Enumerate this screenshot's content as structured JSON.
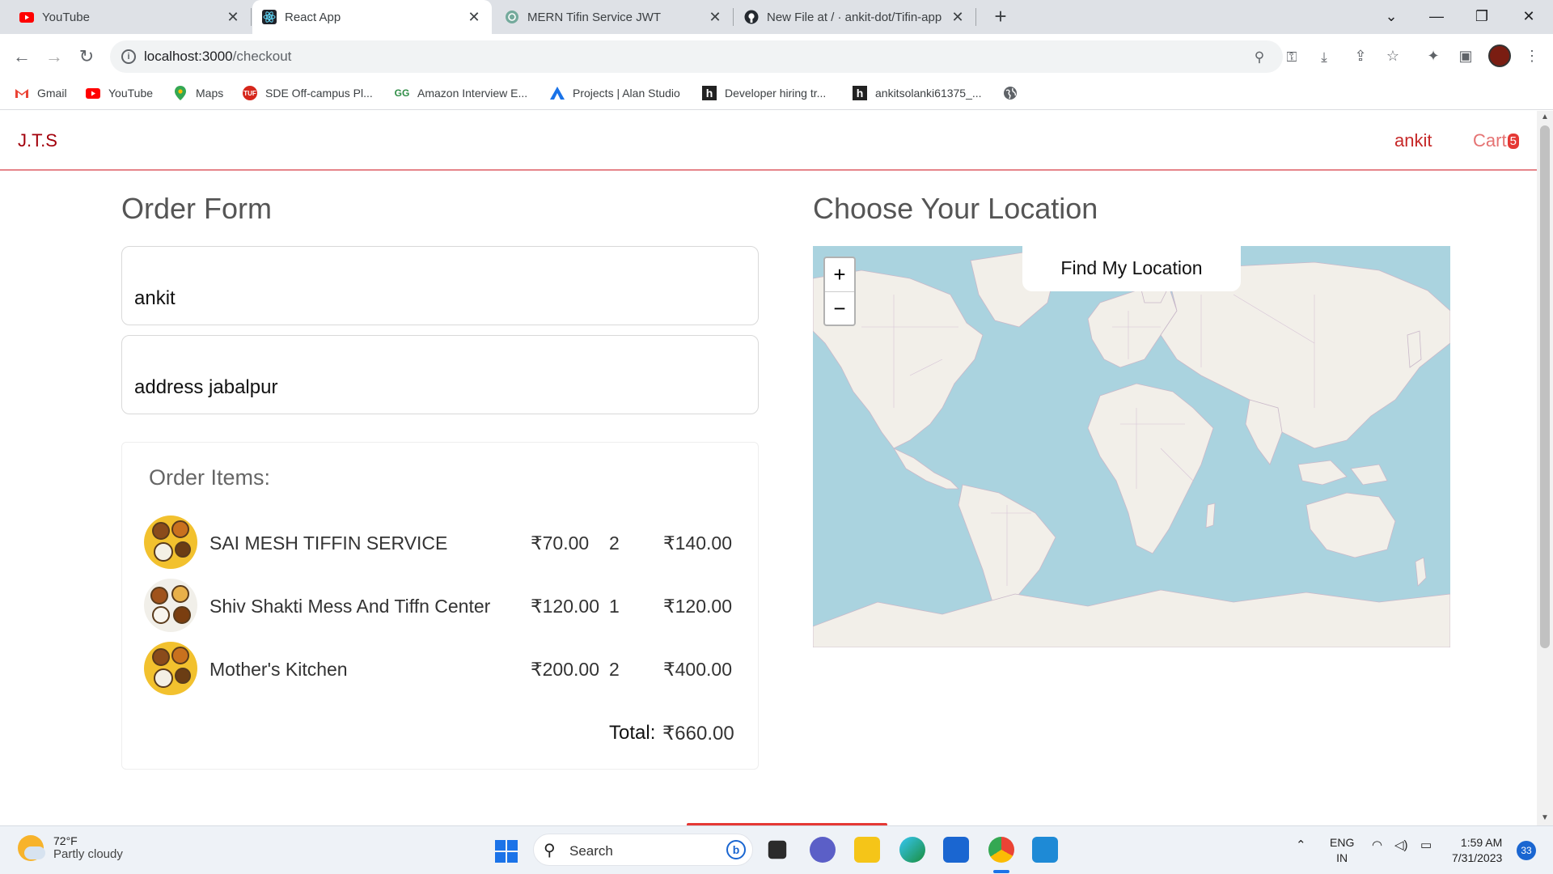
{
  "browser": {
    "tabs": [
      {
        "title": "YouTube",
        "icon": "youtube-icon"
      },
      {
        "title": "React App",
        "icon": "react-icon"
      },
      {
        "title": "MERN Tifin Service JWT",
        "icon": "chatgpt-icon"
      },
      {
        "title": "New File at / · ankit-dot/Tifin-app",
        "icon": "github-icon"
      }
    ],
    "new_tab": "+",
    "url_host": "localhost:3000",
    "url_path": "/checkout",
    "bookmarks": [
      {
        "label": "Gmail",
        "icon": "gmail-icon"
      },
      {
        "label": "YouTube",
        "icon": "youtube-icon"
      },
      {
        "label": "Maps",
        "icon": "maps-icon"
      },
      {
        "label": "SDE Off-campus Pl...",
        "icon": "tuf-icon"
      },
      {
        "label": "Amazon Interview E...",
        "icon": "gfg-icon"
      },
      {
        "label": "Projects | Alan Studio",
        "icon": "alan-icon"
      },
      {
        "label": "Developer hiring tr...",
        "icon": "hackerrank-icon"
      },
      {
        "label": "ankitsolanki61375_...",
        "icon": "hackerrank-icon"
      }
    ]
  },
  "app": {
    "brand": "J.T.S",
    "user": "ankit",
    "cart_label": "Cart",
    "cart_count": "5"
  },
  "order_form": {
    "title": "Order Form",
    "name_value": "ankit",
    "address_value": "address jabalpur",
    "items_title": "Order Items:",
    "items": [
      {
        "name": "SAI MESH TIFFIN SERVICE",
        "price": "₹70.00",
        "qty": "2",
        "total": "₹140.00"
      },
      {
        "name": "Shiv Shakti Mess And Tiffn Center",
        "price": "₹120.00",
        "qty": "1",
        "total": "₹120.00"
      },
      {
        "name": "Mother's Kitchen",
        "price": "₹200.00",
        "qty": "2",
        "total": "₹400.00"
      }
    ],
    "total_label": "Total:",
    "total_value": "₹660.00"
  },
  "location": {
    "title": "Choose Your Location",
    "find_button": "Find My Location",
    "zoom_in": "+",
    "zoom_out": "−"
  },
  "taskbar": {
    "temp": "72°F",
    "weather": "Partly cloudy",
    "search": "Search",
    "lang1": "ENG",
    "lang2": "IN",
    "time": "1:59 AM",
    "date": "7/31/2023",
    "notifications": "33"
  },
  "colors": {
    "brand": "#a3000b",
    "accent": "#e53935",
    "map_water": "#aad3df",
    "map_land": "#f2efe9"
  }
}
